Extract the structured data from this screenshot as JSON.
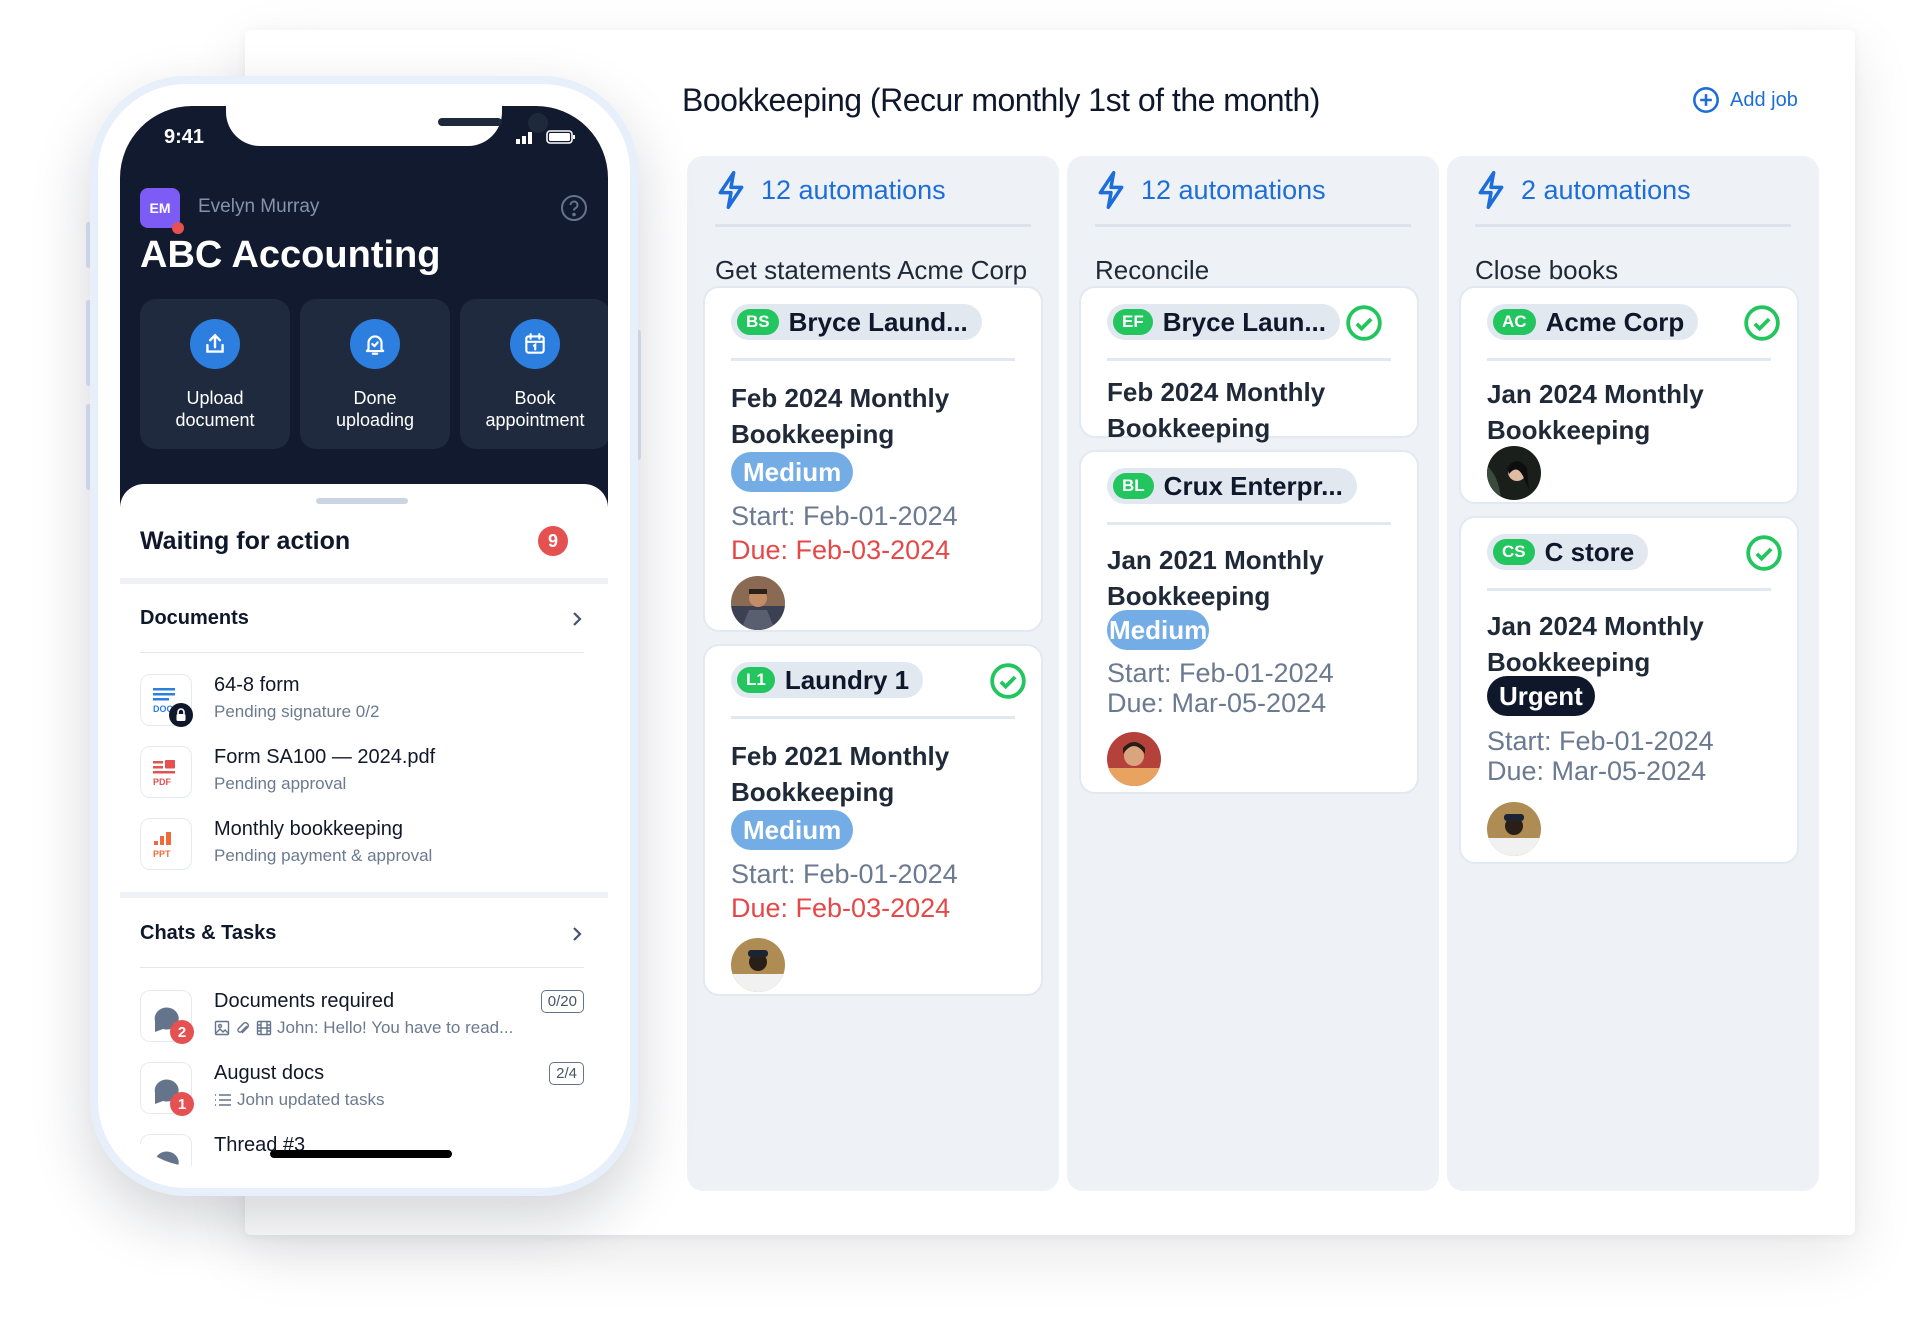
{
  "board": {
    "title": "Bookkeeping (Recur monthly 1st of the month)",
    "add_job_label": "Add job",
    "accent_color": "#1d6ed8",
    "columns": [
      {
        "automations": "12 automations",
        "name": "Get statements Acme Corp",
        "cards": [
          {
            "initials": "BS",
            "client": "Bryce Laund...",
            "done": false,
            "title": "Feb 2024 Monthly Bookkeeping",
            "priority": "Medium",
            "start": "Start: Feb-01-2024",
            "due": "Due: Feb-03-2024",
            "due_overdue": true
          },
          {
            "initials": "L1",
            "client": "Laundry 1",
            "done": true,
            "title": "Feb 2021 Monthly Bookkeeping",
            "priority": "Medium",
            "start": "Start: Feb-01-2024",
            "due": "Due: Feb-03-2024",
            "due_overdue": true
          }
        ]
      },
      {
        "automations": "12 automations",
        "name": "Reconcile",
        "cards": [
          {
            "initials": "EF",
            "client": "Bryce Laun...",
            "done": true,
            "title": "Feb 2024 Monthly Bookkeeping"
          },
          {
            "initials": "BL",
            "client": "Crux Enterpr...",
            "done": false,
            "title": "Jan 2021 Monthly Bookkeeping",
            "priority": "Medium",
            "start": "Start: Feb-01-2024",
            "due": "Due: Mar-05-2024",
            "due_overdue": false
          }
        ]
      },
      {
        "automations": "2 automations",
        "name": "Close books",
        "cards": [
          {
            "initials": "AC",
            "client": "Acme Corp",
            "done": true,
            "title": "Jan 2024 Monthly Bookkeeping"
          },
          {
            "initials": "CS",
            "client": "C store",
            "done": true,
            "title": "Jan 2024 Monthly Bookkeeping",
            "priority": "Urgent",
            "start": "Start: Feb-01-2024",
            "due": "Due: Mar-05-2024",
            "due_overdue": false
          }
        ]
      }
    ]
  },
  "phone": {
    "time": "9:41",
    "user_initials": "EM",
    "user_name": "Evelyn Murray",
    "firm_name": "ABC Accounting",
    "actions": [
      {
        "line1": "Upload",
        "line2": "document",
        "icon": "upload-icon"
      },
      {
        "line1": "Done",
        "line2": "uploading",
        "icon": "bell-check-icon"
      },
      {
        "line1": "Book",
        "line2": "appointment",
        "icon": "calendar-icon"
      }
    ],
    "waiting_title": "Waiting for action",
    "waiting_count": "9",
    "documents_header": "Documents",
    "documents": [
      {
        "type": "DOC",
        "title": "64-8 form",
        "status": "Pending signature 0/2",
        "locked": true
      },
      {
        "type": "PDF",
        "title": "Form SA100 — 2024.pdf",
        "status": "Pending approval"
      },
      {
        "type": "PPT",
        "title": "Monthly bookkeeping",
        "status": "Pending payment & approval"
      }
    ],
    "chats_header": "Chats & Tasks",
    "chats": [
      {
        "title": "Documents required",
        "preview": "John: Hello! You have to read...",
        "unread": "2",
        "progress": "0/20"
      },
      {
        "title": "August docs",
        "preview": "John updated tasks",
        "unread": "1",
        "progress": "2/4"
      },
      {
        "title": "Thread #3"
      }
    ]
  }
}
